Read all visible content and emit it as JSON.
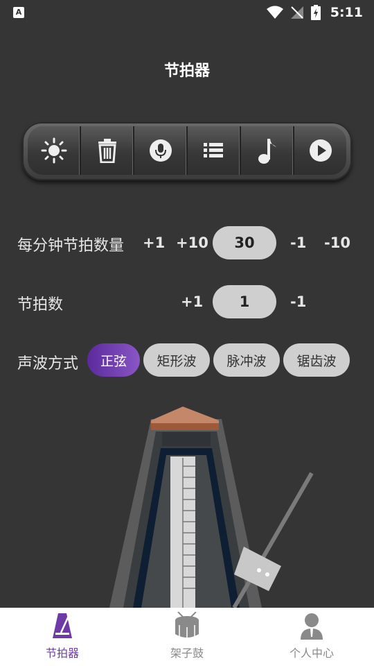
{
  "status": {
    "time": "5:11",
    "notification_icon": "A"
  },
  "header": {
    "title": "节拍器"
  },
  "toolbar": {
    "buttons": [
      "brightness-icon",
      "trash-icon",
      "mic-icon",
      "list-icon",
      "music-note-icon",
      "play-icon"
    ]
  },
  "bpm": {
    "label": "每分钟节拍数量",
    "plus1": "+1",
    "plus10": "+10",
    "value": "30",
    "minus1": "-1",
    "minus10": "-10"
  },
  "beats": {
    "label": "节拍数",
    "plus1": "+1",
    "value": "1",
    "minus1": "-1"
  },
  "waveform": {
    "label": "声波方式",
    "options": [
      "正弦",
      "矩形波",
      "脉冲波",
      "锯齿波"
    ],
    "selected": "正弦"
  },
  "tabs": [
    {
      "label": "节拍器",
      "icon": "metronome-icon",
      "active": true
    },
    {
      "label": "架子鼓",
      "icon": "drum-icon",
      "active": false
    },
    {
      "label": "个人中心",
      "icon": "person-icon",
      "active": false
    }
  ],
  "colors": {
    "background": "#353535",
    "accent": "#6e3aa8",
    "pill": "#cfcfcf"
  }
}
